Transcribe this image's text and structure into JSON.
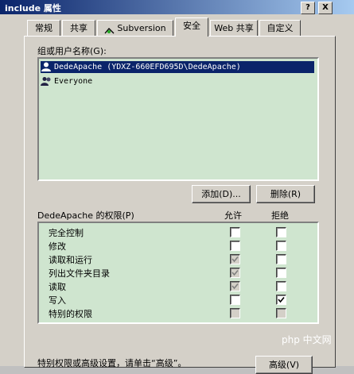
{
  "window": {
    "title": "include 属性",
    "help_btn": "?",
    "close_btn": "X"
  },
  "tabs": [
    "常规",
    "共享",
    "Subversion",
    "安全",
    "Web 共享",
    "自定义"
  ],
  "security": {
    "group_label": "组或用户名称(G):",
    "users": [
      {
        "name": "DedeApache (YDXZ-660EFD695D\\DedeApache)",
        "selected": true
      },
      {
        "name": "Everyone",
        "selected": false
      }
    ],
    "add_button": "添加(D)...",
    "remove_button": "删除(R)",
    "perm_label": "DedeApache 的权限(P)",
    "allow_header": "允许",
    "deny_header": "拒绝",
    "permissions": [
      {
        "name": "完全控制",
        "allow": "unchecked",
        "deny": "unchecked"
      },
      {
        "name": "修改",
        "allow": "unchecked",
        "deny": "unchecked"
      },
      {
        "name": "读取和运行",
        "allow": "checked-disabled",
        "deny": "unchecked"
      },
      {
        "name": "列出文件夹目录",
        "allow": "checked-disabled",
        "deny": "unchecked"
      },
      {
        "name": "读取",
        "allow": "checked-disabled",
        "deny": "unchecked"
      },
      {
        "name": "写入",
        "allow": "unchecked",
        "deny": "checked"
      },
      {
        "name": "特别的权限",
        "allow": "disabled",
        "deny": "disabled"
      }
    ],
    "advanced_hint": "特别权限或高级设置，请单击“高级”。",
    "advanced_button": "高级(V)"
  },
  "watermark": "php 中文网"
}
